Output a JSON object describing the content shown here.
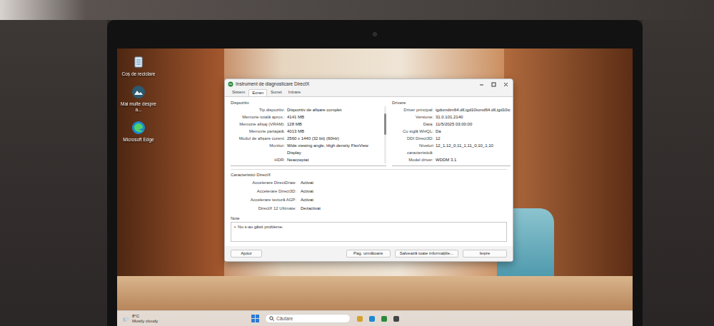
{
  "desktop_icons": [
    {
      "label": "Coș de reciclare"
    },
    {
      "label": "Mai multe despre a..."
    },
    {
      "label": "Microsoft Edge"
    }
  ],
  "window": {
    "title": "Instrument de diagnosticare DirectX"
  },
  "tabs": [
    {
      "label": "Sistem",
      "selected": false
    },
    {
      "label": "Ecran",
      "selected": true
    },
    {
      "label": "Sunet",
      "selected": false
    },
    {
      "label": "Intrare",
      "selected": false
    }
  ],
  "device": {
    "heading": "Dispozitiv",
    "rows": [
      {
        "label": "Tip dispozitiv:",
        "value": "Dispozitiv de afișare complet"
      },
      {
        "label": "Memorie totală aprox.:",
        "value": "4141 MB"
      },
      {
        "label": "Memorie afișaj (VRAM):",
        "value": "128 MB"
      },
      {
        "label": "Memorie partajată:",
        "value": "4013 MB"
      },
      {
        "label": "Modul de afișare curent:",
        "value": "2560 x 1440 (32 bit) (60Hz)"
      },
      {
        "label": "Monitor:",
        "value": "Wide viewing angle, High density FlexView Display"
      },
      {
        "label": "HDR:",
        "value": "Neacceptat"
      }
    ]
  },
  "drivers": {
    "heading": "Drivere",
    "rows": [
      {
        "label": "Driver principal:",
        "value": "igdumdim64.dll,igd10iumd64.dll,igd10ic"
      },
      {
        "label": "Versiune:",
        "value": "31.0.101.2140"
      },
      {
        "label": "Data:",
        "value": "11/5/2025 03:00:00"
      },
      {
        "label": "Cu siglă WHQL:",
        "value": "Da"
      },
      {
        "label": "DDI Direct3D:",
        "value": "12"
      },
      {
        "label": "Niveluri caracteristică:",
        "value": "12_1,12_0,11_1,11_0,10_1,10"
      },
      {
        "label": "Model driver:",
        "value": "WDDM 3.1"
      }
    ]
  },
  "features": {
    "heading": "Caracteristici DirectX",
    "rows": [
      {
        "label": "Accelerare DirectDraw:",
        "value": "Activat"
      },
      {
        "label": "Accelerare Direct3D:",
        "value": "Activat"
      },
      {
        "label": "Accelerare textură AGP:",
        "value": "Activat"
      },
      {
        "label": "DirectX 12 Ultimate:",
        "value": "Dezactivat"
      }
    ]
  },
  "notes": {
    "heading": "Note",
    "items": [
      {
        "bullet": "•",
        "text": "Nu s-au găsit probleme."
      }
    ]
  },
  "buttons": [
    {
      "label": "Ajutor"
    },
    {
      "label": "Pag. următoare"
    },
    {
      "label": "Salvează toate informațiile..."
    },
    {
      "label": "Ieșire"
    }
  ],
  "taskbar": {
    "temperature": "8°C",
    "weather": "Mostly cloudy",
    "search_placeholder": "Căutare"
  }
}
